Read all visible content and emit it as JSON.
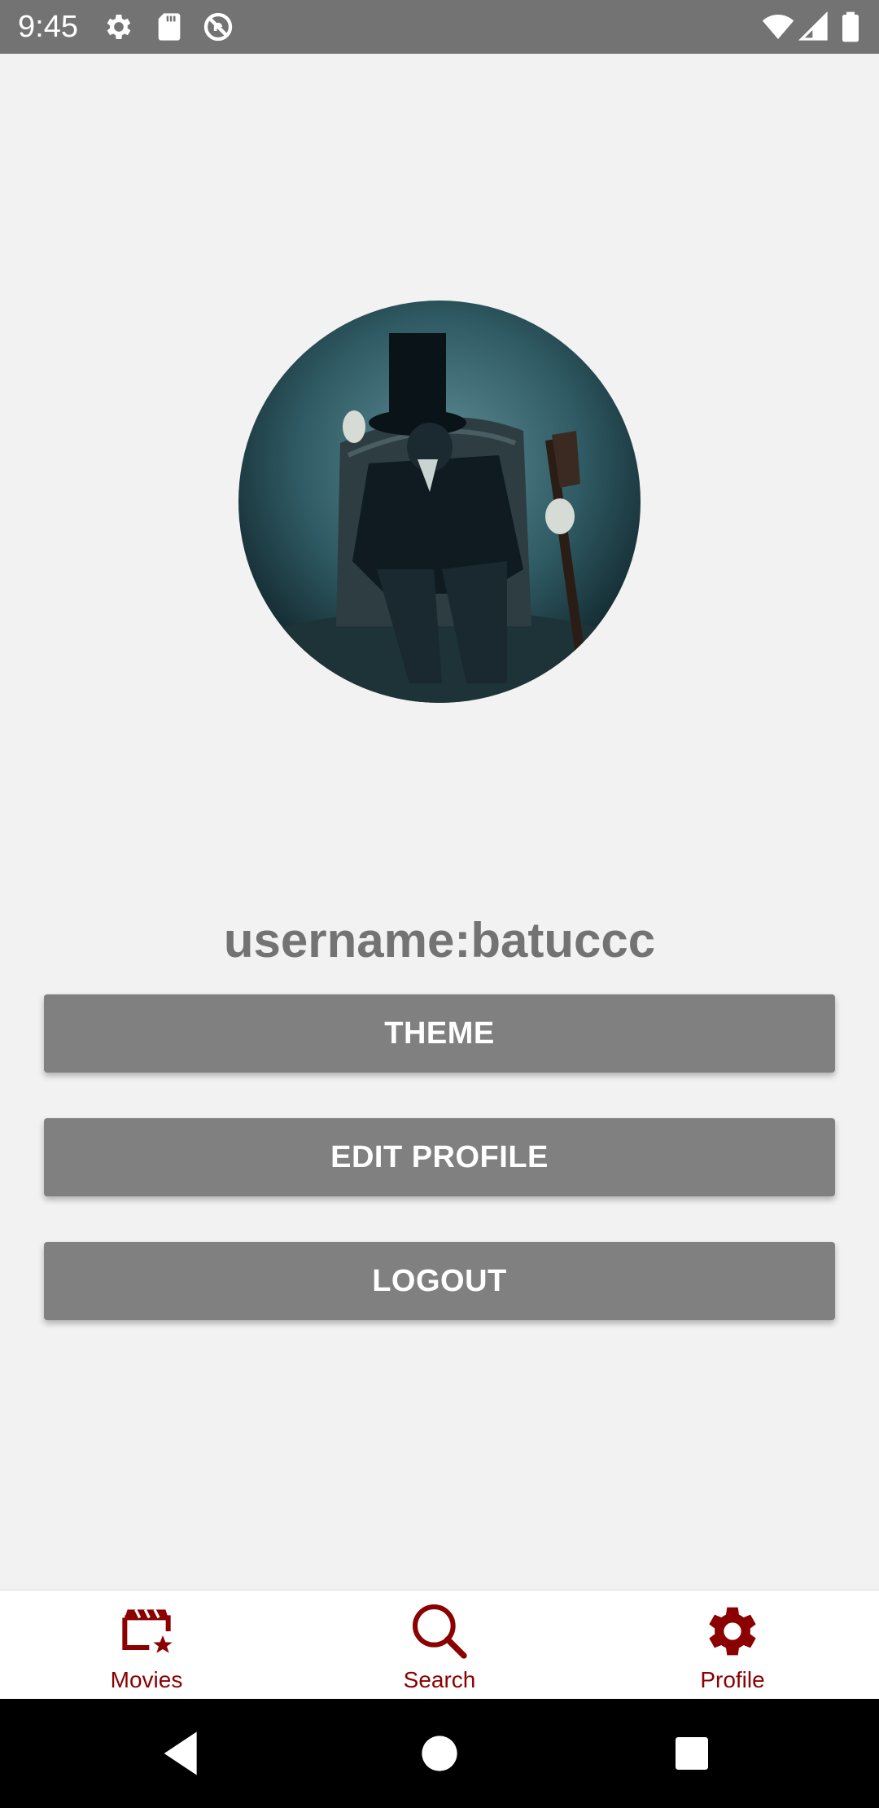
{
  "status_bar": {
    "time": "9:45",
    "left_icons": [
      "settings-icon",
      "sd-card-icon",
      "vpn-icon"
    ],
    "right_icons": [
      "wifi-icon",
      "cellular-signal-icon",
      "battery-icon"
    ]
  },
  "profile": {
    "avatar_icon": "profile-avatar-image",
    "username": "username:batuccc"
  },
  "buttons": {
    "theme": "THEME",
    "edit_profile": "EDIT PROFILE",
    "logout": "LOGOUT"
  },
  "bottom_nav": {
    "items": [
      {
        "label": "Movies",
        "icon": "movie-clapper-icon"
      },
      {
        "label": "Search",
        "icon": "search-icon"
      },
      {
        "label": "Profile",
        "icon": "settings-gear-icon"
      }
    ],
    "color": "#8b0000"
  },
  "system_nav": {
    "buttons": [
      "back-icon",
      "home-icon",
      "recents-icon"
    ]
  },
  "colors": {
    "status_bar": "#737373",
    "button": "#808080",
    "background": "#f2f2f2",
    "accent": "#8b0000"
  }
}
